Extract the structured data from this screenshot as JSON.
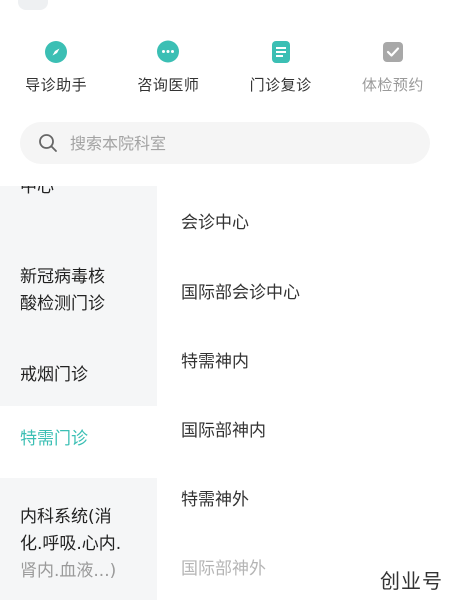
{
  "quick_nav": [
    {
      "label": "导诊助手",
      "icon": "compass-icon",
      "color": "#3bbfb4"
    },
    {
      "label": "咨询医师",
      "icon": "chat-bubble-icon",
      "color": "#3bbfb4"
    },
    {
      "label": "门诊复诊",
      "icon": "document-icon",
      "color": "#3bbfb4"
    },
    {
      "label": "体检预约",
      "icon": "checkbox-icon",
      "color": "#9a9a9a"
    }
  ],
  "search": {
    "placeholder": "搜索本院科室"
  },
  "categories": [
    {
      "label": "中心"
    },
    {
      "label": "新冠病毒核\n酸检测门诊"
    },
    {
      "label": "戒烟门诊"
    },
    {
      "label": "特需门诊",
      "active": true
    },
    {
      "label_main": "内科系统(消\n化.呼吸.心内.",
      "label_faded": "肾内.血液...)"
    }
  ],
  "departments": [
    "会诊中心",
    "国际部会诊中心",
    "特需神内",
    "国际部神内",
    "特需神外",
    "国际部神外"
  ],
  "watermark": "创业号",
  "colors": {
    "accent": "#3bbfb4",
    "sidebar_bg": "#f5f6f7"
  }
}
